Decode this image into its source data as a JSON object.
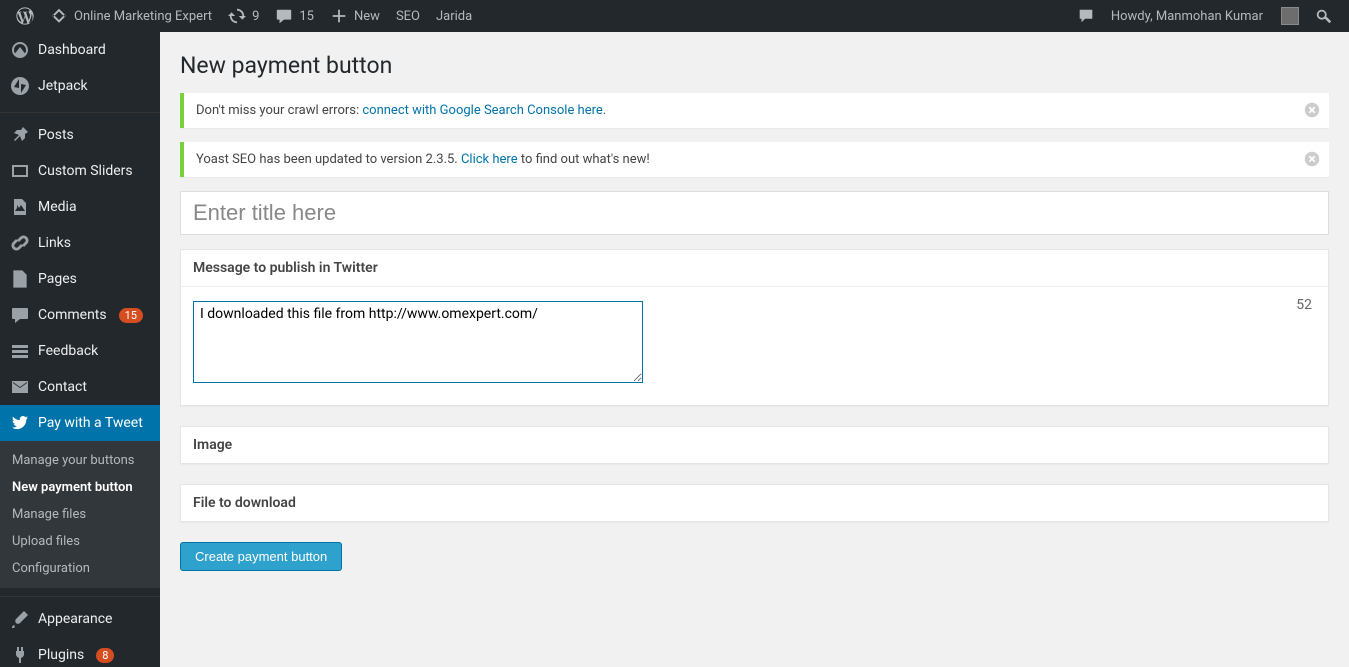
{
  "adminbar": {
    "site_name": "Online Marketing Expert",
    "updates_count": "9",
    "comments_count": "15",
    "new_label": "New",
    "seo_label": "SEO",
    "jarida_label": "Jarida",
    "howdy": "Howdy, Manmohan Kumar"
  },
  "sidebar": {
    "dashboard": "Dashboard",
    "jetpack": "Jetpack",
    "posts": "Posts",
    "custom_sliders": "Custom Sliders",
    "media": "Media",
    "links": "Links",
    "pages": "Pages",
    "comments": "Comments",
    "comments_badge": "15",
    "feedback": "Feedback",
    "contact": "Contact",
    "pay_tweet": "Pay with a Tweet",
    "submenu": {
      "manage_buttons": "Manage your buttons",
      "new_payment": "New payment button",
      "manage_files": "Manage files",
      "upload_files": "Upload files",
      "configuration": "Configuration"
    },
    "appearance": "Appearance",
    "plugins": "Plugins",
    "plugins_badge": "8"
  },
  "page": {
    "title": "New payment button",
    "notice1_text": "Don't miss your crawl errors: ",
    "notice1_link": "connect with Google Search Console here",
    "notice1_after": ".",
    "notice2_text": "Yoast SEO has been updated to version 2.3.5. ",
    "notice2_link": "Click here",
    "notice2_after": " to find out what's new!",
    "title_placeholder": "Enter title here",
    "twitter_box_title": "Message to publish in Twitter",
    "twitter_value": "I downloaded this file from http://www.omexpert.com/",
    "char_count": "52",
    "image_box_title": "Image",
    "file_box_title": "File to download",
    "submit_label": "Create payment button"
  }
}
